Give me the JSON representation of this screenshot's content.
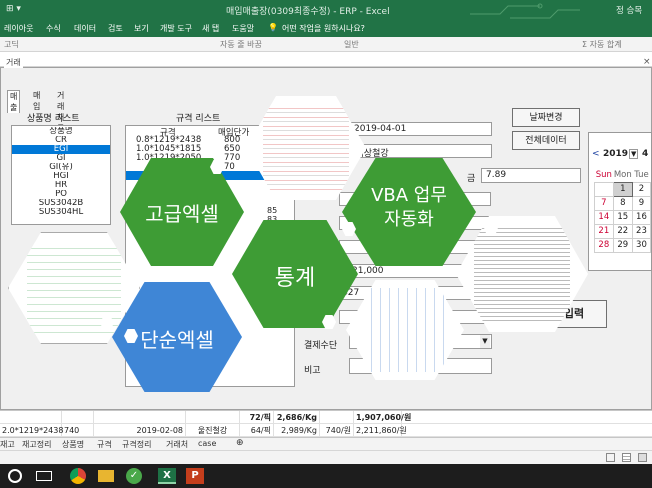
{
  "window": {
    "title": "매입매출장(0309최종수정) - ERP - Excel",
    "user": "정 승목",
    "quick_access": "⊞ ▾"
  },
  "ribbon": {
    "tabs": [
      "레이아웃",
      "수식",
      "데이터",
      "검토",
      "보기",
      "개발 도구",
      "새 탭",
      "도움말"
    ],
    "search": "어떤 작업을 원하시나요?",
    "font_hint": "고딕",
    "autofit": "자동 줄 바꿈",
    "format": "일반",
    "autosum": "Σ 자동 합계"
  },
  "form": {
    "title": "거래",
    "tabs": [
      "매출",
      "매입",
      "거래처등록"
    ],
    "product_list_label": "상품명 리스트",
    "product_items": [
      "상품명",
      "CR",
      "EGI",
      "GI",
      "GI(유)",
      "HGI",
      "HR",
      "PO",
      "SUS3042B",
      "SUS304HL"
    ],
    "selected_product": "EGI",
    "spec_list_label": "규격 리스트",
    "spec_header": [
      "규격",
      "매입단가"
    ],
    "spec_rows": [
      [
        "0.8*1219*2438",
        "800"
      ],
      [
        "1.0*1045*1815",
        "650"
      ],
      [
        "1.0*1219*2050",
        "770"
      ],
      [
        "",
        "70"
      ],
      [
        "",
        ""
      ]
    ],
    "date_value": "2019-04-01",
    "partner_value": ")대상철강",
    "unit_price_label": "금",
    "unit_price_value": "7.89",
    "stat_value_1": "85",
    "stat_value_2": "83",
    "amount_1": "21,000",
    "amount_2": "427",
    "payment_label": "결제수단",
    "note_label": "비고",
    "date_change_button": "날짜변경",
    "all_data_button": "전체데이터",
    "input_button": "입력"
  },
  "overlay": {
    "hex_advanced": "고급엑셀",
    "hex_vba": "VBA 업무 자동화",
    "hex_stats": "통계",
    "hex_basic": "단순엑셀"
  },
  "calendar": {
    "year": "2019",
    "month": "4",
    "weekdays": [
      "Sun",
      "Mon",
      "Tue"
    ],
    "rows": [
      [
        "",
        "1",
        "2"
      ],
      [
        "7",
        "8",
        "9"
      ],
      [
        "14",
        "15",
        "16"
      ],
      [
        "21",
        "22",
        "23"
      ],
      [
        "28",
        "29",
        "30"
      ]
    ],
    "today": "1"
  },
  "sheet": {
    "row1": [
      "",
      "",
      "",
      "",
      "72/픽",
      "2,686/Kg",
      "",
      "1,907,060/원"
    ],
    "row2": [
      "2.0*1219*2438",
      "740",
      "2019-02-08",
      "울진철강",
      "64/픽",
      "2,989/Kg",
      "740/원",
      "2,211,860/원"
    ],
    "tabs": [
      "재고",
      "재고정리",
      "상품명",
      "규격",
      "규격정리",
      "거래처",
      "case"
    ]
  },
  "colors": {
    "excel_green": "#217346",
    "hex_green": "#3e9c35",
    "hex_blue": "#3f86d6",
    "selection_blue": "#0078d7"
  }
}
